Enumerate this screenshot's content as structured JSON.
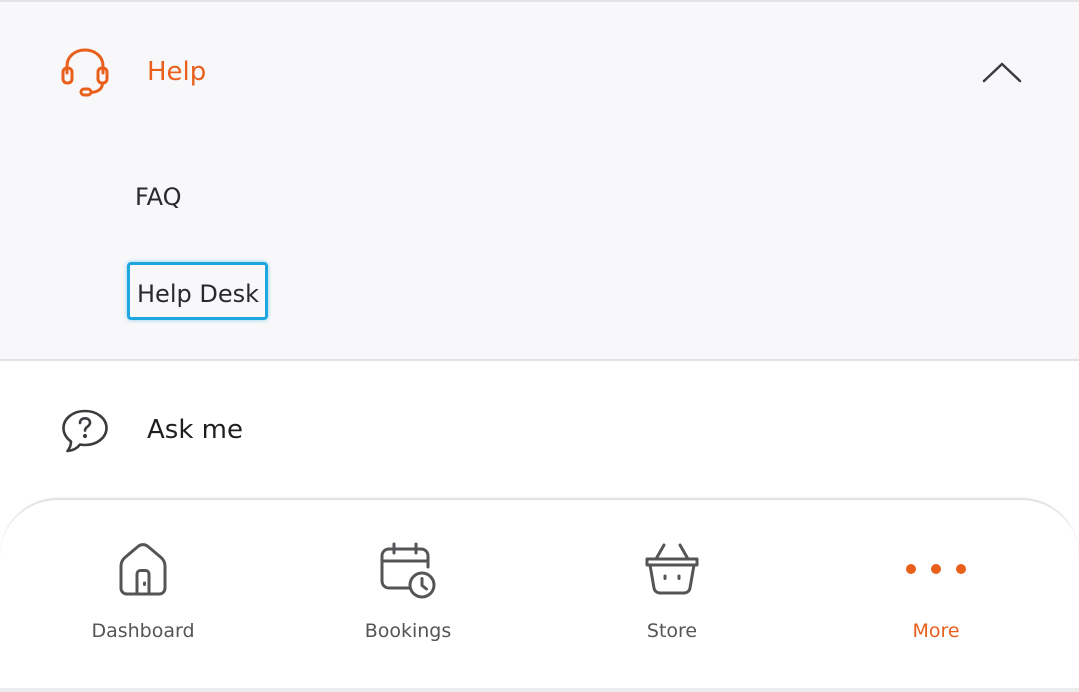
{
  "menu": {
    "help": {
      "title": "Help",
      "icon": "headset-icon",
      "expanded": true,
      "accent_color": "#e8601c",
      "items": [
        {
          "label": "FAQ",
          "focused": false
        },
        {
          "label": "Help Desk",
          "focused": true
        }
      ]
    },
    "ask_me": {
      "title": "Ask me",
      "icon": "question-bubble-icon"
    }
  },
  "bottom_nav": {
    "active": "More",
    "items": [
      {
        "label": "Dashboard",
        "icon": "home-icon"
      },
      {
        "label": "Bookings",
        "icon": "calendar-clock-icon"
      },
      {
        "label": "Store",
        "icon": "basket-icon"
      },
      {
        "label": "More",
        "icon": "more-dots-icon"
      }
    ]
  },
  "colors": {
    "accent": "#e8601c",
    "focus_ring": "#1ea7df",
    "icon_gray": "#555558"
  }
}
